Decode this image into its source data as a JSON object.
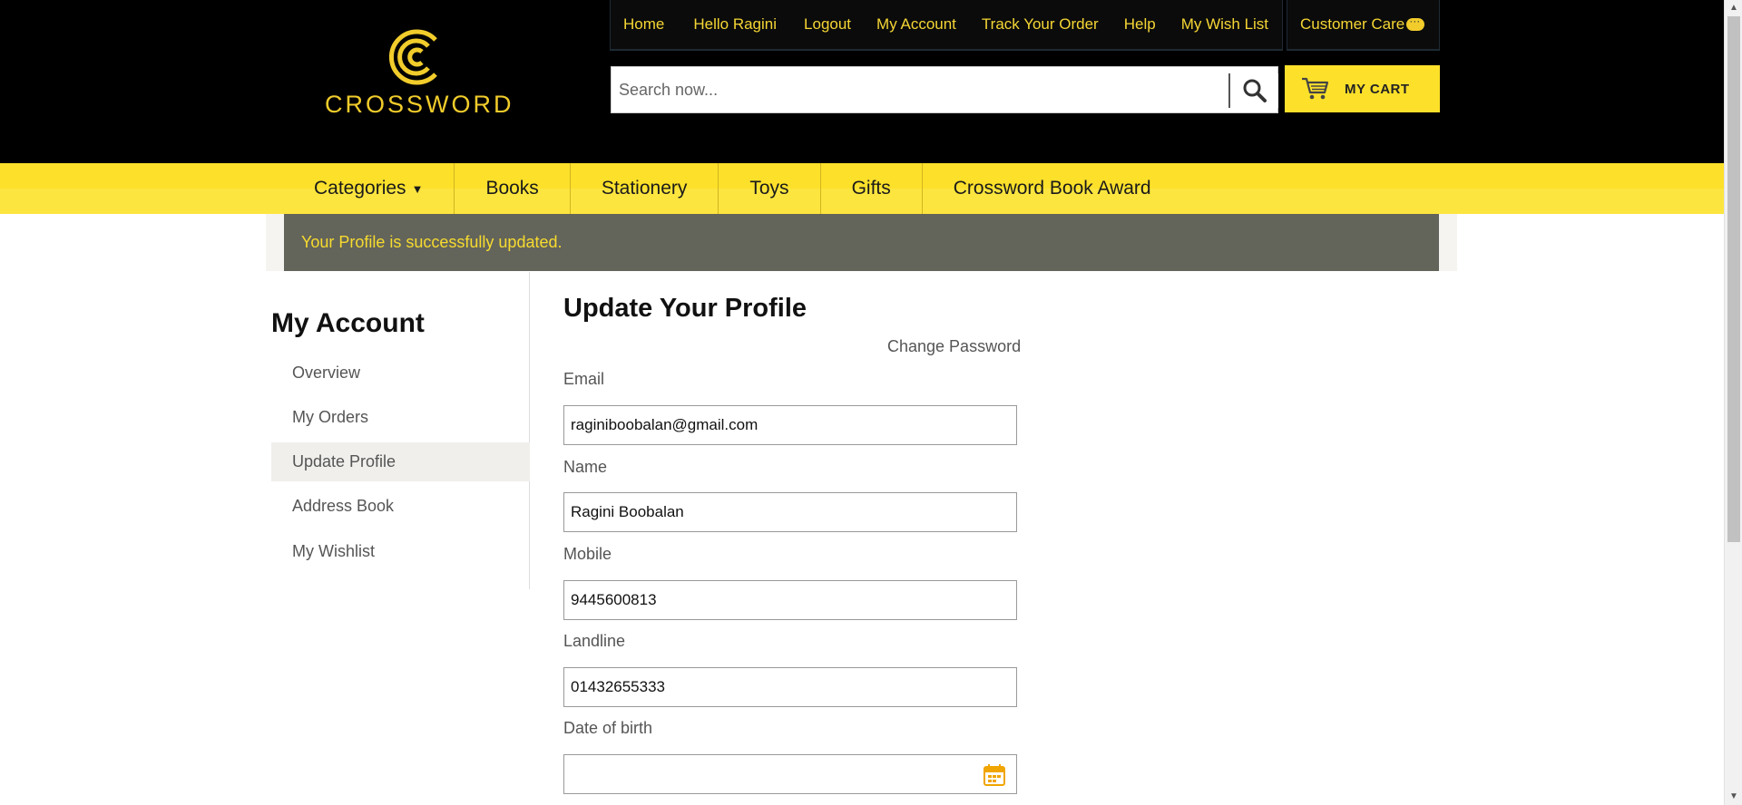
{
  "brand": {
    "name": "CROSSWORD",
    "accent": "#f1cc2b",
    "nav_yellow": "#fde02a"
  },
  "topnav": {
    "links": [
      {
        "label": "Home"
      },
      {
        "label": "Hello Ragini"
      },
      {
        "label": "Logout"
      },
      {
        "label": "My Account"
      },
      {
        "label": "Track Your Order"
      },
      {
        "label": "Help"
      },
      {
        "label": "My Wish List"
      }
    ],
    "customer_care": "Customer Care"
  },
  "search": {
    "placeholder": "Search now...",
    "icon": "search-icon"
  },
  "cart": {
    "label": "MY CART",
    "icon": "cart-icon"
  },
  "mainnav": {
    "items": [
      {
        "label": "Categories"
      },
      {
        "label": "Books"
      },
      {
        "label": "Stationery"
      },
      {
        "label": "Toys"
      },
      {
        "label": "Gifts"
      },
      {
        "label": "Crossword Book Award"
      }
    ]
  },
  "message": "Your Profile is successfully updated.",
  "sidebar": {
    "title": "My Account",
    "items": [
      {
        "label": "Overview"
      },
      {
        "label": "My Orders"
      },
      {
        "label": "Update Profile",
        "active": true
      },
      {
        "label": "Address Book"
      },
      {
        "label": "My Wishlist"
      }
    ]
  },
  "form": {
    "title": "Update Your Profile",
    "change_password": "Change Password",
    "email": {
      "label": "Email",
      "value": "raginiboobalan@gmail.com"
    },
    "name": {
      "label": "Name",
      "value": "Ragini Boobalan"
    },
    "mobile": {
      "label": "Mobile",
      "value": "9445600813"
    },
    "landline": {
      "label": "Landline",
      "value": "01432655333"
    },
    "dob": {
      "label": "Date of birth",
      "value": "",
      "icon": "calendar-icon"
    }
  }
}
